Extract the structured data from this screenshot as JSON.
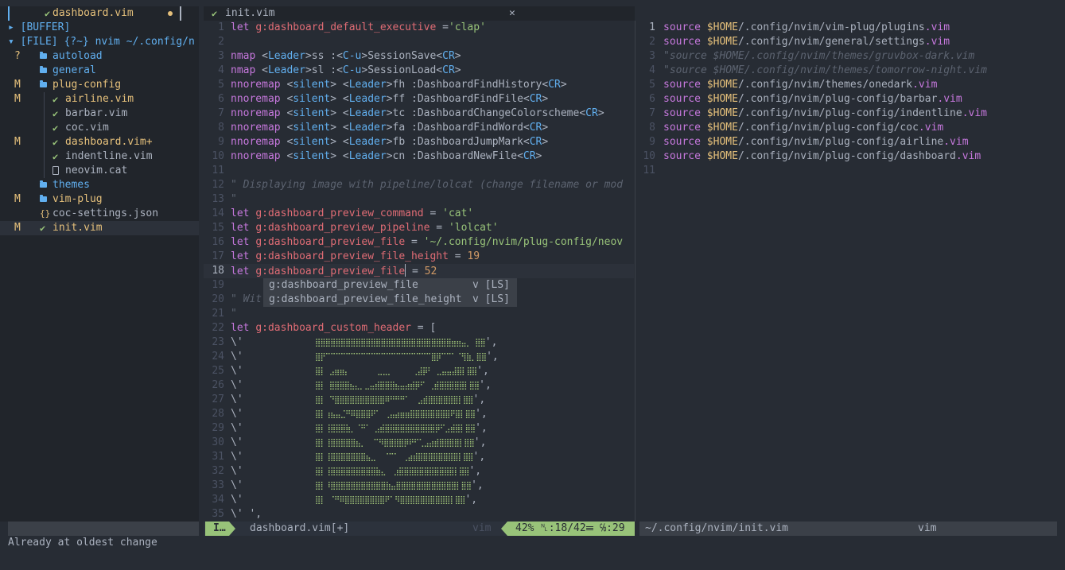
{
  "colors": {
    "background": "#272c34",
    "sidebar": "#21252b",
    "accent_green": "#98c379",
    "accent_blue": "#61afef",
    "modified_yellow": "#e5c07b",
    "keyword_purple": "#c678dd",
    "variable_red": "#e06c75"
  },
  "tree": {
    "rows": [
      {
        "status": "",
        "name": "dashboard.vim",
        "kind": "vim-icon",
        "modified": true
      },
      {
        "status": "",
        "name": "▸ [BUFFER]",
        "kind": "section"
      },
      {
        "status": "",
        "name": "▾ [FILE] {?~} nvim ~/.config/n",
        "kind": "section"
      },
      {
        "status": "?",
        "name": "autoload",
        "kind": "folder-icon"
      },
      {
        "status": "",
        "name": "general",
        "kind": "folder-icon"
      },
      {
        "status": "M",
        "name": "plug-config",
        "kind": "folder-icon",
        "modified": true
      },
      {
        "status": "M",
        "name": "airline.vim",
        "kind": "vim-icon",
        "modified": true
      },
      {
        "status": "",
        "name": "barbar.vim",
        "kind": "vim-icon"
      },
      {
        "status": "",
        "name": "coc.vim",
        "kind": "vim-icon"
      },
      {
        "status": "M",
        "name": "dashboard.vim+",
        "kind": "vim-icon",
        "modified": true
      },
      {
        "status": "",
        "name": "indentline.vim",
        "kind": "vim-icon"
      },
      {
        "status": "",
        "name": "neovim.cat",
        "kind": "file-icon"
      },
      {
        "status": "",
        "name": "themes",
        "kind": "folder-icon"
      },
      {
        "status": "M",
        "name": "vim-plug",
        "kind": "folder-icon",
        "modified": true
      },
      {
        "status": "",
        "name": "coc-settings.json",
        "kind": "json-icon"
      },
      {
        "status": "M",
        "name": "init.vim",
        "kind": "vim-icon",
        "modified": true
      }
    ]
  },
  "tabline": {
    "title": "init.vim",
    "close": "✕"
  },
  "editor_main": {
    "lines": [
      {
        "n": "1",
        "segs": [
          [
            "kw",
            "let "
          ],
          [
            "var",
            "g:dashboard_default_executive"
          ],
          [
            "fn",
            " ="
          ],
          [
            "str",
            "'clap'"
          ]
        ]
      },
      {
        "n": "2",
        "segs": []
      },
      {
        "n": "3",
        "segs": [
          [
            "kw",
            "nmap "
          ],
          [
            "fn",
            "<"
          ],
          [
            "spc",
            "Leader"
          ],
          [
            "fn",
            ">ss :<"
          ],
          [
            "spc",
            "C-u"
          ],
          [
            "fn",
            ">SessionSave<"
          ],
          [
            "spc",
            "CR"
          ],
          [
            "fn",
            ">"
          ]
        ]
      },
      {
        "n": "4",
        "segs": [
          [
            "kw",
            "nmap "
          ],
          [
            "fn",
            "<"
          ],
          [
            "spc",
            "Leader"
          ],
          [
            "fn",
            ">sl :<"
          ],
          [
            "spc",
            "C-u"
          ],
          [
            "fn",
            ">SessionLoad<"
          ],
          [
            "spc",
            "CR"
          ],
          [
            "fn",
            ">"
          ]
        ]
      },
      {
        "n": "5",
        "segs": [
          [
            "kw",
            "nnoremap "
          ],
          [
            "fn",
            "<"
          ],
          [
            "spc",
            "silent"
          ],
          [
            "fn",
            "> <"
          ],
          [
            "spc",
            "Leader"
          ],
          [
            "fn",
            ">fh :DashboardFindHistory<"
          ],
          [
            "spc",
            "CR"
          ],
          [
            "fn",
            ">"
          ]
        ]
      },
      {
        "n": "6",
        "segs": [
          [
            "kw",
            "nnoremap "
          ],
          [
            "fn",
            "<"
          ],
          [
            "spc",
            "silent"
          ],
          [
            "fn",
            "> <"
          ],
          [
            "spc",
            "Leader"
          ],
          [
            "fn",
            ">ff :DashboardFindFile<"
          ],
          [
            "spc",
            "CR"
          ],
          [
            "fn",
            ">"
          ]
        ]
      },
      {
        "n": "7",
        "segs": [
          [
            "kw",
            "nnoremap "
          ],
          [
            "fn",
            "<"
          ],
          [
            "spc",
            "silent"
          ],
          [
            "fn",
            "> <"
          ],
          [
            "spc",
            "Leader"
          ],
          [
            "fn",
            ">tc :DashboardChangeColorscheme<"
          ],
          [
            "spc",
            "CR"
          ],
          [
            "fn",
            ">"
          ]
        ]
      },
      {
        "n": "8",
        "segs": [
          [
            "kw",
            "nnoremap "
          ],
          [
            "fn",
            "<"
          ],
          [
            "spc",
            "silent"
          ],
          [
            "fn",
            "> <"
          ],
          [
            "spc",
            "Leader"
          ],
          [
            "fn",
            ">fa :DashboardFindWord<"
          ],
          [
            "spc",
            "CR"
          ],
          [
            "fn",
            ">"
          ]
        ]
      },
      {
        "n": "9",
        "segs": [
          [
            "kw",
            "nnoremap "
          ],
          [
            "fn",
            "<"
          ],
          [
            "spc",
            "silent"
          ],
          [
            "fn",
            "> <"
          ],
          [
            "spc",
            "Leader"
          ],
          [
            "fn",
            ">fb :DashboardJumpMark<"
          ],
          [
            "spc",
            "CR"
          ],
          [
            "fn",
            ">"
          ]
        ]
      },
      {
        "n": "10",
        "segs": [
          [
            "kw",
            "nnoremap "
          ],
          [
            "fn",
            "<"
          ],
          [
            "spc",
            "silent"
          ],
          [
            "fn",
            "> <"
          ],
          [
            "spc",
            "Leader"
          ],
          [
            "fn",
            ">cn :DashboardNewFile<"
          ],
          [
            "spc",
            "CR"
          ],
          [
            "fn",
            ">"
          ]
        ]
      },
      {
        "n": "11",
        "segs": []
      },
      {
        "n": "12",
        "segs": [
          [
            "cmt",
            "\" Displaying image with pipeline/lolcat (change filename or mod"
          ]
        ]
      },
      {
        "n": "13",
        "segs": [
          [
            "cmt",
            "\""
          ]
        ]
      },
      {
        "n": "14",
        "segs": [
          [
            "kw",
            "let "
          ],
          [
            "var",
            "g:dashboard_preview_command"
          ],
          [
            "fn",
            " = "
          ],
          [
            "str",
            "'cat'"
          ]
        ]
      },
      {
        "n": "15",
        "segs": [
          [
            "kw",
            "let "
          ],
          [
            "var",
            "g:dashboard_preview_pipeline"
          ],
          [
            "fn",
            " = "
          ],
          [
            "str",
            "'lolcat'"
          ]
        ]
      },
      {
        "n": "16",
        "segs": [
          [
            "kw",
            "let "
          ],
          [
            "var",
            "g:dashboard_preview_file"
          ],
          [
            "fn",
            " = "
          ],
          [
            "str",
            "'~/.config/nvim/plug-config/neov"
          ]
        ]
      },
      {
        "n": "17",
        "segs": [
          [
            "kw",
            "let "
          ],
          [
            "var",
            "g:dashboard_preview_file_height"
          ],
          [
            "fn",
            " = "
          ],
          [
            "num",
            "19"
          ]
        ]
      },
      {
        "n": "18",
        "cur": true,
        "segs": [
          [
            "kw",
            "let "
          ],
          [
            "var",
            "g:dashboard_preview_file"
          ],
          [
            "cursor",
            ""
          ],
          [
            "fn",
            " = "
          ],
          [
            "num",
            "52"
          ]
        ]
      },
      {
        "n": "19",
        "segs": []
      },
      {
        "n": "20",
        "segs": [
          [
            "cmt",
            "\" Wit"
          ]
        ]
      },
      {
        "n": "21",
        "segs": [
          [
            "cmt",
            "\""
          ]
        ]
      },
      {
        "n": "22",
        "segs": [
          [
            "kw",
            "let "
          ],
          [
            "var",
            "g:dashboard_custom_header"
          ],
          [
            "fn",
            " = ["
          ]
        ]
      },
      {
        "n": "23",
        "segs": [
          [
            "fn",
            "\\'"
          ],
          [
            "art",
            "                  ⣿⣿⣿⣿⣿⣿⣿⣿⣿⣿⣿⣿⣿⣿⣿⣿⣿⣿⣿⣿⣿⣿⣿⣿⣿⣿⣿⣶⣶⣤⡀ ⣿⣿"
          ],
          [
            "fn",
            "',"
          ]
        ]
      },
      {
        "n": "24",
        "segs": [
          [
            "fn",
            "\\'"
          ],
          [
            "art",
            "                  ⣿⡟⠉⠉⠉⠉⠉⠉⠉⠉⠉⠉⠉⠉⠉⠉⠉⠉⠉⠉⠉⠉⠉⣿⡿⠉⠉⠁⠈⢻⣷⡀⣿⣿"
          ],
          [
            "fn",
            "',"
          ]
        ]
      },
      {
        "n": "25",
        "segs": [
          [
            "fn",
            "\\'"
          ],
          [
            "art",
            "                  ⣿⡇ ⣠⣶⣶⡄       ⣀⣀⡀     ⢀⣼⡿⠃ ⣀⣤⣤⣼⣿⡇⣿⣿"
          ],
          [
            "fn",
            "',"
          ]
        ]
      },
      {
        "n": "26",
        "segs": [
          [
            "fn",
            "\\'"
          ],
          [
            "art",
            "                  ⣿⡇ ⣿⣿⣿⣿⣦⣄⡀⣀⣤⣾⣿⣿⣿⣦⣤⣴⣾⡿⠋ ⢀⣾⣿⣿⣿⣿⣿⡇⣿⣿"
          ],
          [
            "fn",
            "',"
          ]
        ]
      },
      {
        "n": "27",
        "segs": [
          [
            "fn",
            "\\'"
          ],
          [
            "art",
            "                  ⣿⡇ ⠙⣿⣿⣿⣿⣿⣿⣿⣿⣿⣿⠿⠛⠛⠛⠁  ⣠⣾⣿⣿⣿⣿⣿⣿⡇⣿⣿"
          ],
          [
            "fn",
            "',"
          ]
        ]
      },
      {
        "n": "28",
        "segs": [
          [
            "fn",
            "\\'"
          ],
          [
            "art",
            "                  ⣿⡇⢰⣦⣤⣈⠛⠿⣿⣿⣿⠟⠁ ⢀⣤⣴⣶⣶⣿⣿⣿⣿⣿⣿⣿⣿⠟⣿⡇⣿⣿"
          ],
          [
            "fn",
            "',"
          ]
        ]
      },
      {
        "n": "29",
        "segs": [
          [
            "fn",
            "\\'"
          ],
          [
            "art",
            "                  ⣿⡇⢸⣿⣿⣿⣷⡀⠈⠛⠁ ⣠⣾⣿⣿⣿⣿⣿⣿⣿⣿⣿⣿⡿⠋⣠⣾⣿⡇⣿⣿"
          ],
          [
            "fn",
            "',"
          ]
        ]
      },
      {
        "n": "30",
        "segs": [
          [
            "fn",
            "\\'"
          ],
          [
            "art",
            "                  ⣿⡇⢸⣿⣿⣿⣿⣿⣦⡀  ⠉⠻⣿⣿⣿⣿⡿⠟⠋⢁⣠⣴⣾⣿⣿⣿⣿⡇⣿⣿"
          ],
          [
            "fn",
            "',"
          ]
        ]
      },
      {
        "n": "31",
        "segs": [
          [
            "fn",
            "\\'"
          ],
          [
            "art",
            "                  ⣿⡇⢸⣿⣿⣿⣿⣿⣿⣿⣦⣀  ⠈⠉⠁ ⢀⣴⣾⣿⣿⣿⣿⣿⣿⣿⣿⡇⣿⣿"
          ],
          [
            "fn",
            "',"
          ]
        ]
      },
      {
        "n": "32",
        "segs": [
          [
            "fn",
            "\\'"
          ],
          [
            "art",
            "                  ⣿⡇⢸⣿⣿⣿⣿⣿⣿⣿⣿⣿⣷⣄  ⣰⣿⣿⣿⣿⣿⣿⣿⣿⣿⣿⣿⡇⣿⣿"
          ],
          [
            "fn",
            "',"
          ]
        ]
      },
      {
        "n": "33",
        "segs": [
          [
            "fn",
            "\\'"
          ],
          [
            "art",
            "                  ⣿⡇⠸⣿⣿⣿⣿⣿⣿⣿⣿⣿⣿⣿⣷⣤⣿⣿⣿⣿⣿⣿⣿⣿⣿⣿⣿⣿⡇⣿⣿"
          ],
          [
            "fn",
            "',"
          ]
        ]
      },
      {
        "n": "34",
        "segs": [
          [
            "fn",
            "\\'"
          ],
          [
            "art",
            "                  ⣿⡇ ⠈⠛⠿⣿⣿⣿⣿⣿⣿⣿⣿⠟⠁⠻⣿⣿⣿⣿⣿⣿⣿⣿⣿⣿⡇⣿⣿"
          ],
          [
            "fn",
            "',"
          ]
        ]
      },
      {
        "n": "35",
        "segs": [
          [
            "fn",
            "\\' ',"
          ]
        ]
      }
    ]
  },
  "completion": {
    "items": [
      {
        "word": "g:dashboard_preview_file",
        "kind": "v [LS]"
      },
      {
        "word": "g:dashboard_preview_file_height",
        "kind": "v [LS]"
      }
    ]
  },
  "editor_right": {
    "lines": [
      {
        "n": "1",
        "cur": true,
        "segs": [
          [
            "kw",
            "source "
          ],
          [
            "env",
            "$HOME"
          ],
          [
            "fn",
            "/.config/nvim/vim-plug/plugins"
          ],
          [
            "kw",
            ".vim"
          ]
        ]
      },
      {
        "n": "2",
        "segs": [
          [
            "kw",
            "source "
          ],
          [
            "env",
            "$HOME"
          ],
          [
            "fn",
            "/.config/nvim/general/settings"
          ],
          [
            "kw",
            ".vim"
          ]
        ]
      },
      {
        "n": "3",
        "segs": [
          [
            "cmt",
            "\"source $HOME/.config/nvim/themes/gruvbox-dark.vim"
          ]
        ]
      },
      {
        "n": "4",
        "segs": [
          [
            "cmt",
            "\"source $HOME/.config/nvim/themes/tomorrow-night.vim"
          ]
        ]
      },
      {
        "n": "5",
        "segs": [
          [
            "kw",
            "source "
          ],
          [
            "env",
            "$HOME"
          ],
          [
            "fn",
            "/.config/nvim/themes/onedark"
          ],
          [
            "kw",
            ".vim"
          ]
        ]
      },
      {
        "n": "6",
        "segs": [
          [
            "kw",
            "source "
          ],
          [
            "env",
            "$HOME"
          ],
          [
            "fn",
            "/.config/nvim/plug-config/barbar"
          ],
          [
            "kw",
            ".vim"
          ]
        ]
      },
      {
        "n": "7",
        "segs": [
          [
            "kw",
            "source "
          ],
          [
            "env",
            "$HOME"
          ],
          [
            "fn",
            "/.config/nvim/plug-config/indentline"
          ],
          [
            "kw",
            ".vim"
          ]
        ]
      },
      {
        "n": "8",
        "segs": [
          [
            "kw",
            "source "
          ],
          [
            "env",
            "$HOME"
          ],
          [
            "fn",
            "/.config/nvim/plug-config/coc"
          ],
          [
            "kw",
            ".vim"
          ]
        ]
      },
      {
        "n": "9",
        "segs": [
          [
            "kw",
            "source "
          ],
          [
            "env",
            "$HOME"
          ],
          [
            "fn",
            "/.config/nvim/plug-config/airline"
          ],
          [
            "kw",
            ".vim"
          ]
        ]
      },
      {
        "n": "10",
        "segs": [
          [
            "kw",
            "source "
          ],
          [
            "env",
            "$HOME"
          ],
          [
            "fn",
            "/.config/nvim/plug-config/dashboard"
          ],
          [
            "kw",
            ".vim"
          ]
        ]
      },
      {
        "n": "11",
        "segs": []
      }
    ]
  },
  "statusline": {
    "mode": "I…",
    "file": "dashboard.vim[+]",
    "filetype": "vim",
    "position": "42% ␤:18/42☰ ℅:29",
    "right_path": "~/.config/nvim/init.vim",
    "right_filetype": "vim"
  },
  "cmdline": "Already at oldest change"
}
